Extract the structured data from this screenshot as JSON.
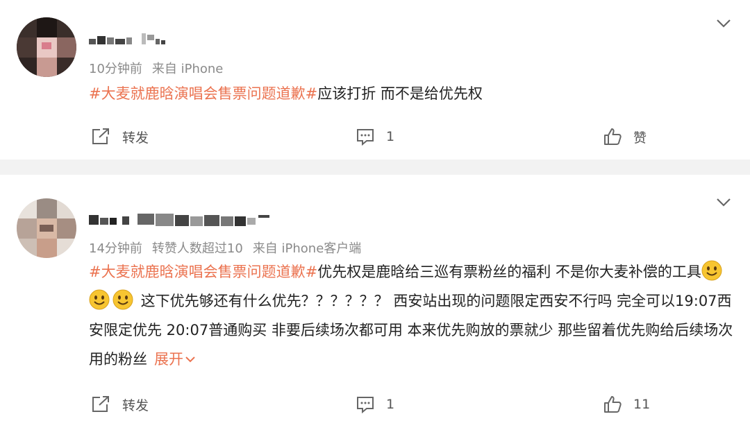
{
  "posts": [
    {
      "username": "",
      "time": "10分钟前",
      "source": "来自 iPhone",
      "topic": "#大麦就鹿晗演唱会售票问题道歉#",
      "text": "应该打折 而不是给优先权",
      "actions": {
        "repost_label": "转发",
        "comment_count": "1",
        "like_label": "赞"
      }
    },
    {
      "username": "",
      "time": "14分钟前",
      "stat": "转赞人数超过10",
      "source": "来自 iPhone客户端",
      "topic": "#大麦就鹿晗演唱会售票问题道歉#",
      "text_part1": "优先权是鹿晗给三巡有票粉丝的福利 不是你大麦补偿的工具",
      "text_part2": " 这下优先够还有什么优先？？？？？？ 西安站出现的问题限定西安不行吗 完全可以19:07西安限定优先 20:07普通购买 非要后续场次都可用 本来优先购放的票就少 那些留着优先购给后续场次用的粉丝",
      "expand_label": "展开",
      "actions": {
        "repost_label": "转发",
        "comment_count": "1",
        "like_count": "11"
      }
    }
  ],
  "colors": {
    "topic": "#eb7350",
    "meta": "#8a8a8a",
    "divider": "#f2f2f2"
  }
}
